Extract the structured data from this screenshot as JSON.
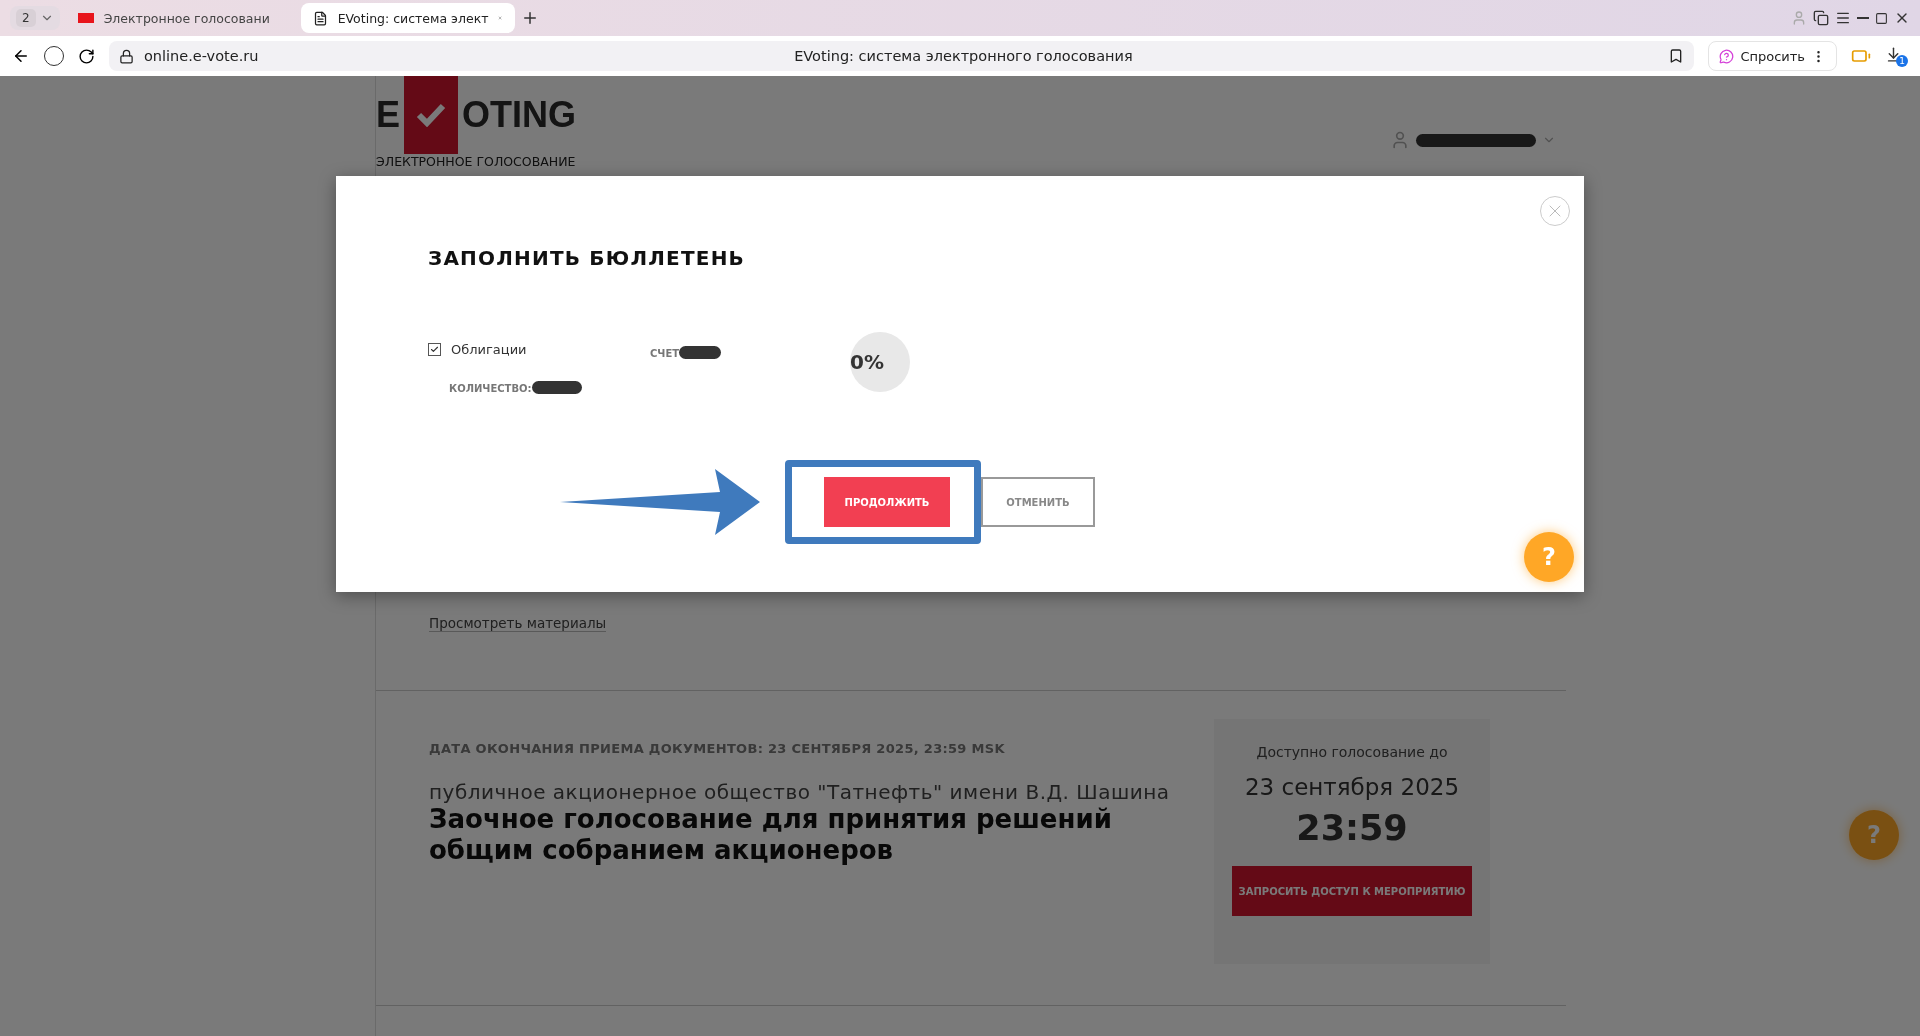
{
  "browser": {
    "tab_count": "2",
    "tabs": [
      {
        "title": "Электронное голосовани",
        "selected": false
      },
      {
        "title": "EVoting: система элект",
        "selected": true
      }
    ],
    "address": "online.e-vote.ru",
    "page_title": "EVoting: система электронного голосования",
    "ask_button": "Спросить",
    "download_count": "1"
  },
  "header": {
    "logo_left": "E",
    "logo_right": "OTING",
    "subtitle": "ЭЛЕКТРОННОЕ ГОЛОСОВАНИЕ"
  },
  "page": {
    "materials_link": "Просмотреть материалы",
    "event": {
      "deadline": "ДАТА ОКОНЧАНИЯ ПРИЕМА ДОКУМЕНТОВ: **23 СЕНТЯБРЯ 2025, 23:59 MSK**",
      "company": "публичное акционерное общество \"Татнефть\" имени В.Д. Шашина",
      "title": "Заочное голосование для принятия решений общим собранием акционеров",
      "card": {
        "label": "Доступно голосование до",
        "date": "23 сентября 2025",
        "time": "23:59",
        "button": "ЗАПРОСИТЬ ДОСТУП К МЕРОПРИЯТИЮ"
      }
    },
    "help_button": "?"
  },
  "modal": {
    "title": "ЗАПОЛНИТЬ БЮЛЛЕТЕНЬ",
    "item": {
      "label": "Облигации",
      "checked": true,
      "quantity_label": "КОЛИЧЕСТВО:",
      "account_label": "СЧЕТ",
      "progress": "0%"
    },
    "buttons": [
      {
        "label": "ПРОДОЛЖИТЬ",
        "kind": "primary",
        "highlighted": true
      },
      {
        "label": "ОТМЕНИТЬ",
        "kind": "secondary",
        "highlighted": false
      }
    ],
    "help_button": "?"
  }
}
